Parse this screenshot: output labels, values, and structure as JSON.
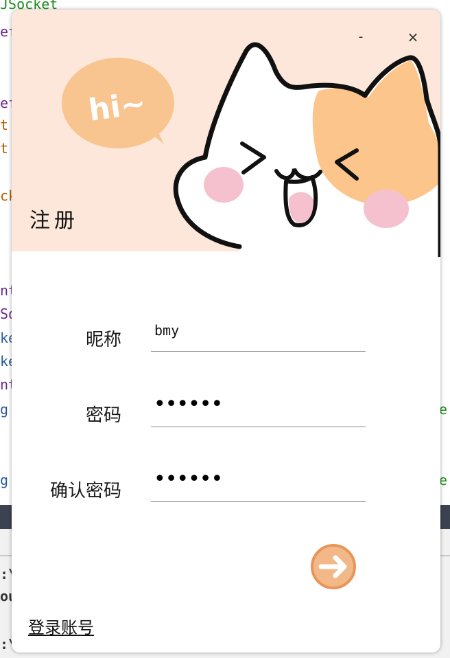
{
  "background": {
    "code_lines": [
      {
        "text": "JSocket",
        "color": "#1a8a1a"
      },
      {
        "text": "ef",
        "color": "#6a2a8a"
      },
      {
        "text": "ef",
        "color": "#6a2a8a"
      },
      {
        "text": "t",
        "color": "#b85c00"
      },
      {
        "text": "t",
        "color": "#b85c00"
      },
      {
        "text": "ck",
        "color": "#b85c00"
      },
      {
        "text": "nt",
        "color": "#6a2a8a"
      },
      {
        "text": "So",
        "color": "#6a2a8a"
      },
      {
        "text": "ke",
        "color": "#2a5a9a"
      },
      {
        "text": "ke",
        "color": "#2a5a9a"
      },
      {
        "text": "nt",
        "color": "#6a2a8a"
      },
      {
        "text": "g",
        "color": "#2a5a9a"
      },
      {
        "text": "g",
        "color": "#2a5a9a"
      }
    ],
    "panel_rows": [
      ":\\",
      "ou",
      ":\\"
    ]
  },
  "window": {
    "minimize_label": "-",
    "close_label": "×",
    "title": "注册"
  },
  "bubble_text": "hi~",
  "form": {
    "nickname": {
      "label": "昵称",
      "value": "bmy"
    },
    "password": {
      "label": "密码",
      "value": "••••••"
    },
    "confirm_password": {
      "label": "确认密码",
      "value": "••••••"
    }
  },
  "submit_icon": "arrow-right-icon",
  "login_link": "登录账号",
  "colors": {
    "banner": "#fce7da",
    "bubble": "#f8c48f",
    "cat_patch": "#fbc58c",
    "blush": "#f5c1cf",
    "button_fill": "#f3b888",
    "button_ring": "#e8955a"
  }
}
